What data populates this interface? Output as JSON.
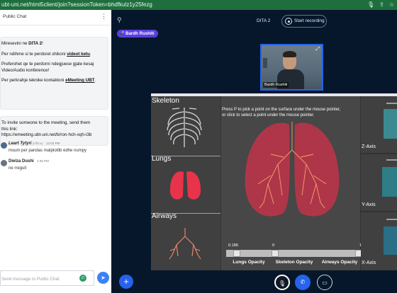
{
  "browser": {
    "url": "ubt-uni.net/html5client/join?sessionToken=bhdfkulz1y25fezg"
  },
  "chat": {
    "title": "Public Chat",
    "welcome": {
      "line1_pre": "Miresevini ne ",
      "line1_bold": "DITA 2",
      "line1_post": "!",
      "line2_pre": "Per ndihme si te perdoret shikoni ",
      "line2_link": "videot ketu",
      "line2_post": ".",
      "line3": "Preferohet qe te perdorni ndegjuese gjate kesaj Video/Audio konference!",
      "line4_pre": "Per perkrahje teknike kontaktoni ",
      "line4_link": "eMeeting UBT",
      "line4_post": "."
    },
    "invite": {
      "line1": "To invite someone to the meeting, send them",
      "line2": "this link:",
      "link": "https://emeeting.ubt-uni.net/b/ron-hch-xqh-i3b"
    },
    "messages": [
      {
        "name": "Leart Tytyri",
        "sub": "(offline)",
        "time": "12:03 PM",
        "text": "msum per pandas matplotlib edhe numpy"
      },
      {
        "name": "Dielza Dushi",
        "sub": "",
        "time": "1:35 PM",
        "text": "ne rregull"
      }
    ],
    "compose_placeholder": "Send message to Public Chat"
  },
  "header": {
    "session_name": "DITA 2",
    "record_label": "Start recording",
    "presenter": "Bardh Rushiti"
  },
  "webcam": {
    "name": "Bardh Rushiti"
  },
  "screen_share": {
    "panels": [
      "Skeleton",
      "Lungs",
      "Airways"
    ],
    "hint": [
      "Press P to pick a point on the surface under the mouse pointer,",
      "or click to select a point under the mouse pointer."
    ],
    "sliders": [
      {
        "label": "Lungs Opacity",
        "value": "0.186",
        "fraction": 0.186
      },
      {
        "label": "Skeleton Opacity",
        "value": "0",
        "fraction": 0.0
      },
      {
        "label": "Airways Opacity",
        "value": "1",
        "fraction": 1.0
      }
    ],
    "axes": [
      "Z-Axis",
      "Y-Axis",
      "X-Axis"
    ]
  },
  "colors": {
    "accent": "#2563eb",
    "presenter_badge": "#5b3fe0",
    "background": "#06172b",
    "url_bar": "#1f6f3e"
  }
}
